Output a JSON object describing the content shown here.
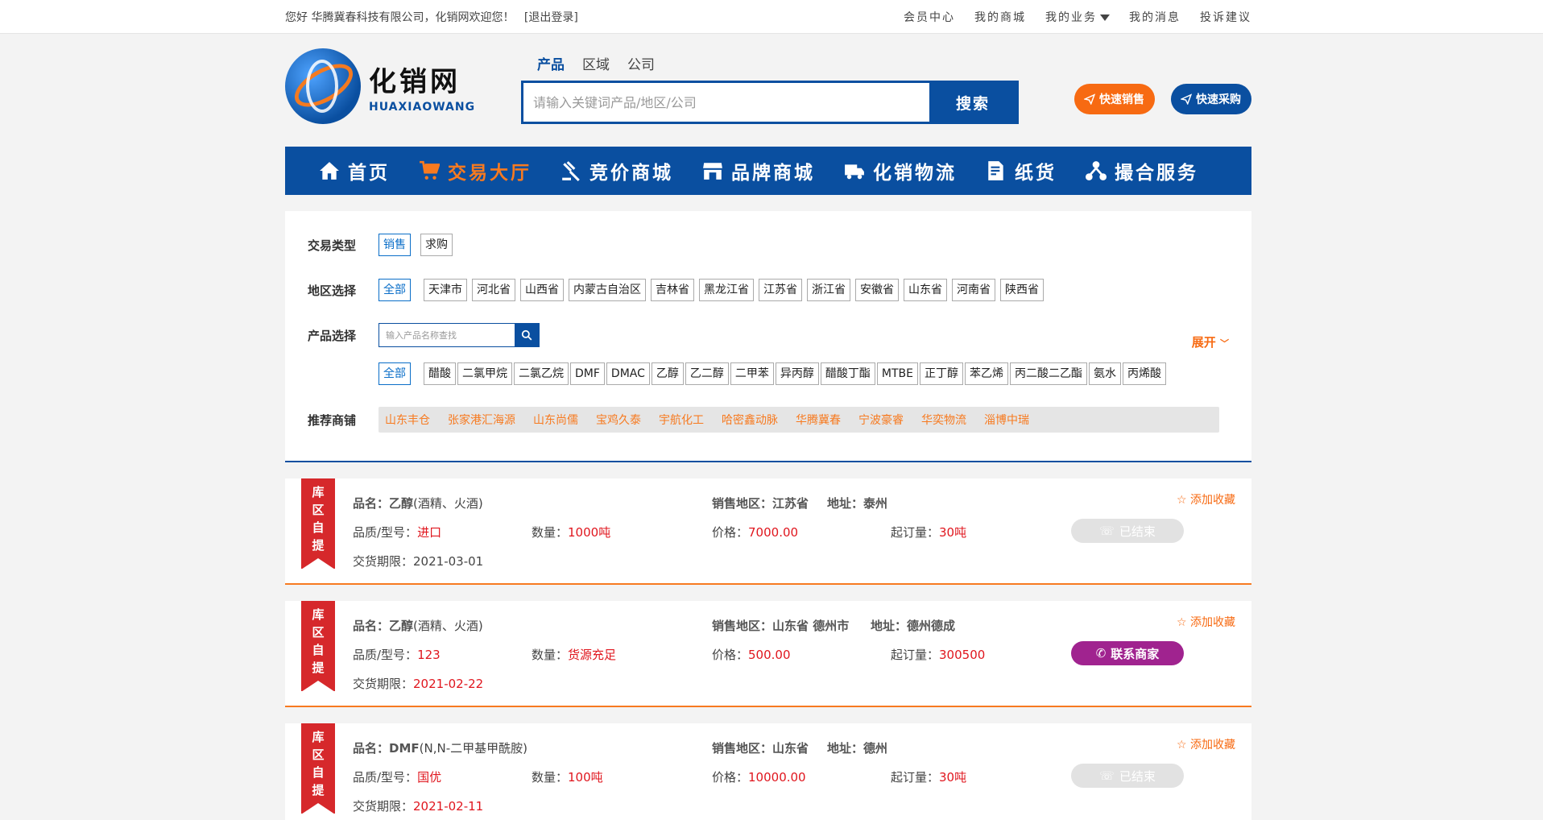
{
  "topbar": {
    "greeting": "您好  华腾冀春科技有限公司，化销网欢迎您！",
    "logout": "[退出登录]",
    "links": [
      "会员中心",
      "我的商城",
      "我的业务",
      "我的消息",
      "投诉建议"
    ]
  },
  "logo": {
    "cn": "化销网",
    "en": "HUAXIAOWANG"
  },
  "search": {
    "tabs": [
      "产品",
      "区域",
      "公司"
    ],
    "placeholder": "请输入关键词产品/地区/公司",
    "button": "搜索"
  },
  "quick": {
    "sell": "快速销售",
    "buy": "快速采购"
  },
  "nav": [
    {
      "label": "首页",
      "icon": "home-icon"
    },
    {
      "label": "交易大厅",
      "icon": "cart-icon"
    },
    {
      "label": "竞价商城",
      "icon": "gavel-icon"
    },
    {
      "label": "品牌商城",
      "icon": "store-icon"
    },
    {
      "label": "化销物流",
      "icon": "truck-icon"
    },
    {
      "label": "纸货",
      "icon": "document-icon"
    },
    {
      "label": "撮合服务",
      "icon": "network-icon"
    }
  ],
  "filters": {
    "trade_type_label": "交易类型",
    "trade_types": [
      "销售",
      "求购"
    ],
    "region_label": "地区选择",
    "regions_all": "全部",
    "regions": [
      "天津市",
      "河北省",
      "山西省",
      "内蒙古自治区",
      "吉林省",
      "黑龙江省",
      "江苏省",
      "浙江省",
      "安徽省",
      "山东省",
      "河南省",
      "陕西省"
    ],
    "product_label": "产品选择",
    "product_placeholder": "输入产品名称查找",
    "expand": "展开",
    "products_all": "全部",
    "products": [
      "醋酸",
      "二氯甲烷",
      "二氯乙烷",
      "DMF",
      "DMAC",
      "乙醇",
      "乙二醇",
      "二甲苯",
      "异丙醇",
      "醋酸丁酯",
      "MTBE",
      "正丁醇",
      "苯乙烯",
      "丙二酸二乙酯",
      "氨水",
      "丙烯酸"
    ],
    "shops_label": "推荐商铺",
    "shops": [
      "山东丰仓",
      "张家港汇海源",
      "山东尚儒",
      "宝鸡久泰",
      "宇航化工",
      "哈密鑫动脉",
      "华腾冀春",
      "宁波豪睿",
      "华奕物流",
      "淄博中瑞"
    ]
  },
  "labels": {
    "name": "品名：",
    "region": "销售地区：",
    "address": "地址：",
    "quality": "品质/型号：",
    "qty": "数量：",
    "price": "价格：",
    "min_order": "起订量：",
    "deadline": "交货期限：",
    "fav": "添加收藏",
    "ribbon": [
      "库",
      "区",
      "自",
      "提"
    ]
  },
  "listings": [
    {
      "name": "乙醇",
      "alias": "(酒精、火酒)",
      "region": "江苏省",
      "address": "泰州",
      "quality": "进口",
      "qty": "1000吨",
      "price": "7000.00",
      "min_order": "30吨",
      "deadline": "2021-03-01",
      "status": "已结束"
    },
    {
      "name": "乙醇",
      "alias": "(酒精、火酒)",
      "region": "山东省 德州市",
      "address": "德州德成",
      "quality": "123",
      "qty": "货源充足",
      "price": "500.00",
      "min_order": "300500",
      "deadline": "2021-02-22",
      "status": "联系商家"
    },
    {
      "name": "DMF",
      "alias": "(N,N-二甲基甲酰胺)",
      "region": "山东省",
      "address": "德州",
      "quality": "国优",
      "qty": "100吨",
      "price": "10000.00",
      "min_order": "30吨",
      "deadline": "2021-02-11",
      "status": "已结束"
    }
  ]
}
